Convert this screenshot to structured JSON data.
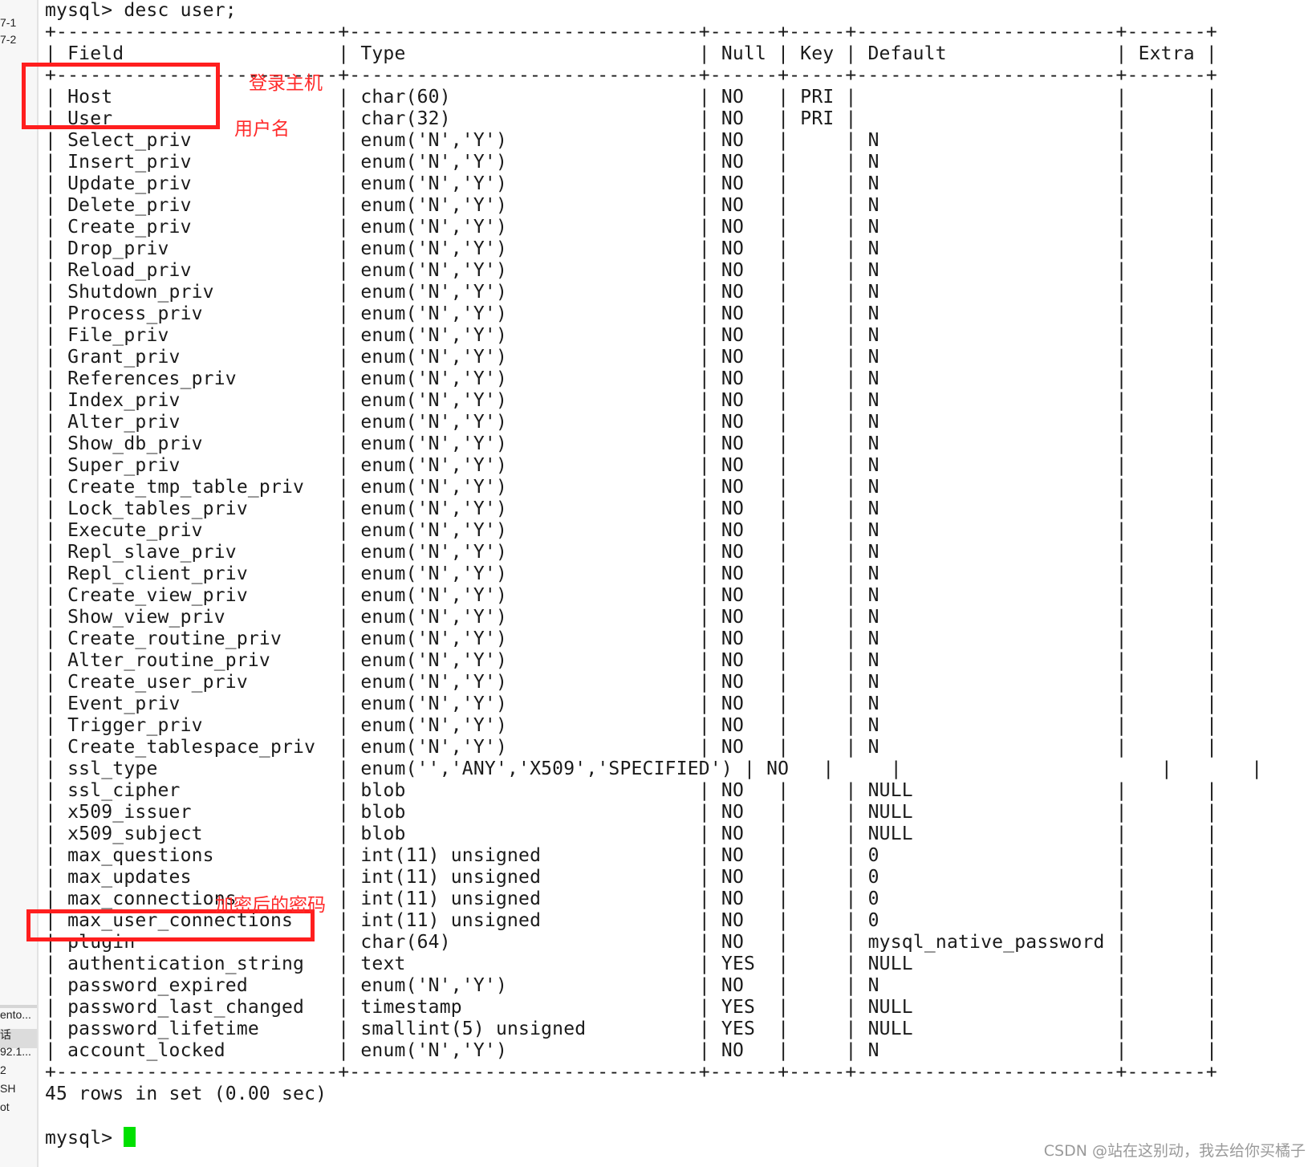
{
  "sidebar": {
    "items": [
      "7-1",
      "7-2",
      "ento...",
      "话",
      "92.1...",
      "2",
      "SH",
      "ot"
    ]
  },
  "terminal": {
    "command_line": "mysql> desc user;",
    "separator": "+-------------------------+-------------------------------+------+-----+-----------------------+-------+",
    "header": "| Field                   | Type                          | Null | Key | Default               | Extra |",
    "rows": [
      {
        "field": "Host",
        "type": "char(60)",
        "null": "NO",
        "key": "PRI",
        "default": "",
        "extra": ""
      },
      {
        "field": "User",
        "type": "char(32)",
        "null": "NO",
        "key": "PRI",
        "default": "",
        "extra": ""
      },
      {
        "field": "Select_priv",
        "type": "enum('N','Y')",
        "null": "NO",
        "key": "",
        "default": "N",
        "extra": ""
      },
      {
        "field": "Insert_priv",
        "type": "enum('N','Y')",
        "null": "NO",
        "key": "",
        "default": "N",
        "extra": ""
      },
      {
        "field": "Update_priv",
        "type": "enum('N','Y')",
        "null": "NO",
        "key": "",
        "default": "N",
        "extra": ""
      },
      {
        "field": "Delete_priv",
        "type": "enum('N','Y')",
        "null": "NO",
        "key": "",
        "default": "N",
        "extra": ""
      },
      {
        "field": "Create_priv",
        "type": "enum('N','Y')",
        "null": "NO",
        "key": "",
        "default": "N",
        "extra": ""
      },
      {
        "field": "Drop_priv",
        "type": "enum('N','Y')",
        "null": "NO",
        "key": "",
        "default": "N",
        "extra": ""
      },
      {
        "field": "Reload_priv",
        "type": "enum('N','Y')",
        "null": "NO",
        "key": "",
        "default": "N",
        "extra": ""
      },
      {
        "field": "Shutdown_priv",
        "type": "enum('N','Y')",
        "null": "NO",
        "key": "",
        "default": "N",
        "extra": ""
      },
      {
        "field": "Process_priv",
        "type": "enum('N','Y')",
        "null": "NO",
        "key": "",
        "default": "N",
        "extra": ""
      },
      {
        "field": "File_priv",
        "type": "enum('N','Y')",
        "null": "NO",
        "key": "",
        "default": "N",
        "extra": ""
      },
      {
        "field": "Grant_priv",
        "type": "enum('N','Y')",
        "null": "NO",
        "key": "",
        "default": "N",
        "extra": ""
      },
      {
        "field": "References_priv",
        "type": "enum('N','Y')",
        "null": "NO",
        "key": "",
        "default": "N",
        "extra": ""
      },
      {
        "field": "Index_priv",
        "type": "enum('N','Y')",
        "null": "NO",
        "key": "",
        "default": "N",
        "extra": ""
      },
      {
        "field": "Alter_priv",
        "type": "enum('N','Y')",
        "null": "NO",
        "key": "",
        "default": "N",
        "extra": ""
      },
      {
        "field": "Show_db_priv",
        "type": "enum('N','Y')",
        "null": "NO",
        "key": "",
        "default": "N",
        "extra": ""
      },
      {
        "field": "Super_priv",
        "type": "enum('N','Y')",
        "null": "NO",
        "key": "",
        "default": "N",
        "extra": ""
      },
      {
        "field": "Create_tmp_table_priv",
        "type": "enum('N','Y')",
        "null": "NO",
        "key": "",
        "default": "N",
        "extra": ""
      },
      {
        "field": "Lock_tables_priv",
        "type": "enum('N','Y')",
        "null": "NO",
        "key": "",
        "default": "N",
        "extra": ""
      },
      {
        "field": "Execute_priv",
        "type": "enum('N','Y')",
        "null": "NO",
        "key": "",
        "default": "N",
        "extra": ""
      },
      {
        "field": "Repl_slave_priv",
        "type": "enum('N','Y')",
        "null": "NO",
        "key": "",
        "default": "N",
        "extra": ""
      },
      {
        "field": "Repl_client_priv",
        "type": "enum('N','Y')",
        "null": "NO",
        "key": "",
        "default": "N",
        "extra": ""
      },
      {
        "field": "Create_view_priv",
        "type": "enum('N','Y')",
        "null": "NO",
        "key": "",
        "default": "N",
        "extra": ""
      },
      {
        "field": "Show_view_priv",
        "type": "enum('N','Y')",
        "null": "NO",
        "key": "",
        "default": "N",
        "extra": ""
      },
      {
        "field": "Create_routine_priv",
        "type": "enum('N','Y')",
        "null": "NO",
        "key": "",
        "default": "N",
        "extra": ""
      },
      {
        "field": "Alter_routine_priv",
        "type": "enum('N','Y')",
        "null": "NO",
        "key": "",
        "default": "N",
        "extra": ""
      },
      {
        "field": "Create_user_priv",
        "type": "enum('N','Y')",
        "null": "NO",
        "key": "",
        "default": "N",
        "extra": ""
      },
      {
        "field": "Event_priv",
        "type": "enum('N','Y')",
        "null": "NO",
        "key": "",
        "default": "N",
        "extra": ""
      },
      {
        "field": "Trigger_priv",
        "type": "enum('N','Y')",
        "null": "NO",
        "key": "",
        "default": "N",
        "extra": ""
      },
      {
        "field": "Create_tablespace_priv",
        "type": "enum('N','Y')",
        "null": "NO",
        "key": "",
        "default": "N",
        "extra": ""
      },
      {
        "field": "ssl_type",
        "type": "enum('','ANY','X509','SPECIFIED')",
        "null": "NO",
        "key": "",
        "default": "",
        "extra": ""
      },
      {
        "field": "ssl_cipher",
        "type": "blob",
        "null": "NO",
        "key": "",
        "default": "NULL",
        "extra": ""
      },
      {
        "field": "x509_issuer",
        "type": "blob",
        "null": "NO",
        "key": "",
        "default": "NULL",
        "extra": ""
      },
      {
        "field": "x509_subject",
        "type": "blob",
        "null": "NO",
        "key": "",
        "default": "NULL",
        "extra": ""
      },
      {
        "field": "max_questions",
        "type": "int(11) unsigned",
        "null": "NO",
        "key": "",
        "default": "0",
        "extra": ""
      },
      {
        "field": "max_updates",
        "type": "int(11) unsigned",
        "null": "NO",
        "key": "",
        "default": "0",
        "extra": ""
      },
      {
        "field": "max_connections",
        "type": "int(11) unsigned",
        "null": "NO",
        "key": "",
        "default": "0",
        "extra": ""
      },
      {
        "field": "max_user_connections",
        "type": "int(11) unsigned",
        "null": "NO",
        "key": "",
        "default": "0",
        "extra": ""
      },
      {
        "field": "plugin",
        "type": "char(64)",
        "null": "NO",
        "key": "",
        "default": "mysql_native_password",
        "extra": ""
      },
      {
        "field": "authentication_string",
        "type": "text",
        "null": "YES",
        "key": "",
        "default": "NULL",
        "extra": ""
      },
      {
        "field": "password_expired",
        "type": "enum('N','Y')",
        "null": "NO",
        "key": "",
        "default": "N",
        "extra": ""
      },
      {
        "field": "password_last_changed",
        "type": "timestamp",
        "null": "YES",
        "key": "",
        "default": "NULL",
        "extra": ""
      },
      {
        "field": "password_lifetime",
        "type": "smallint(5) unsigned",
        "null": "YES",
        "key": "",
        "default": "NULL",
        "extra": ""
      },
      {
        "field": "account_locked",
        "type": "enum('N','Y')",
        "null": "NO",
        "key": "",
        "default": "N",
        "extra": ""
      }
    ],
    "result_line": "45 rows in set (0.00 sec)",
    "prompt": "mysql> "
  },
  "annotations": {
    "host_label": "登录主机",
    "user_label": "用户名",
    "auth_label": "加密后的密码",
    "color": "#ff1e1e"
  },
  "watermark": "CSDN @站在这别动，我去给你买橘子",
  "colors": {
    "cursor": "#00e000",
    "text": "#1a1a1a",
    "background": "#ffffff"
  }
}
